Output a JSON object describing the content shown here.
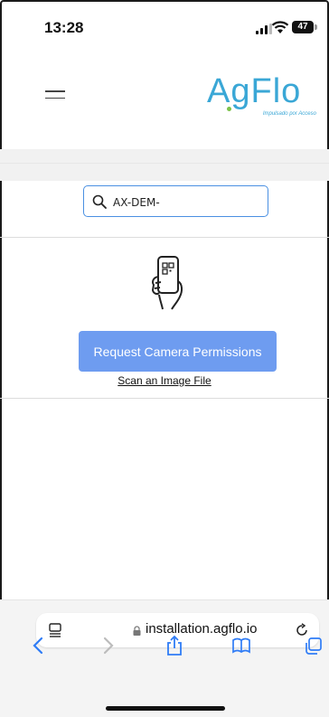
{
  "status_bar": {
    "time": "13:28",
    "battery": "47"
  },
  "header": {
    "logo_text": "AgFlo",
    "logo_tagline": "Impulsado por Acceso",
    "colors": {
      "logo_blue": "#3aa7d6",
      "logo_green": "#7cc24a"
    }
  },
  "search": {
    "value": "AX-DEM-"
  },
  "scanner": {
    "icon": "phone-qr-hand-icon",
    "button_label": "Request Camera Permissions",
    "link_label": "Scan an Image File",
    "colors": {
      "button": "#6e9cf0"
    }
  },
  "safari": {
    "url": "installation.agflo.io",
    "icons": [
      "tabs-icon",
      "lock-icon",
      "reload-icon",
      "back-icon",
      "forward-icon",
      "share-icon",
      "bookmarks-icon",
      "tabs-overview-icon"
    ]
  }
}
